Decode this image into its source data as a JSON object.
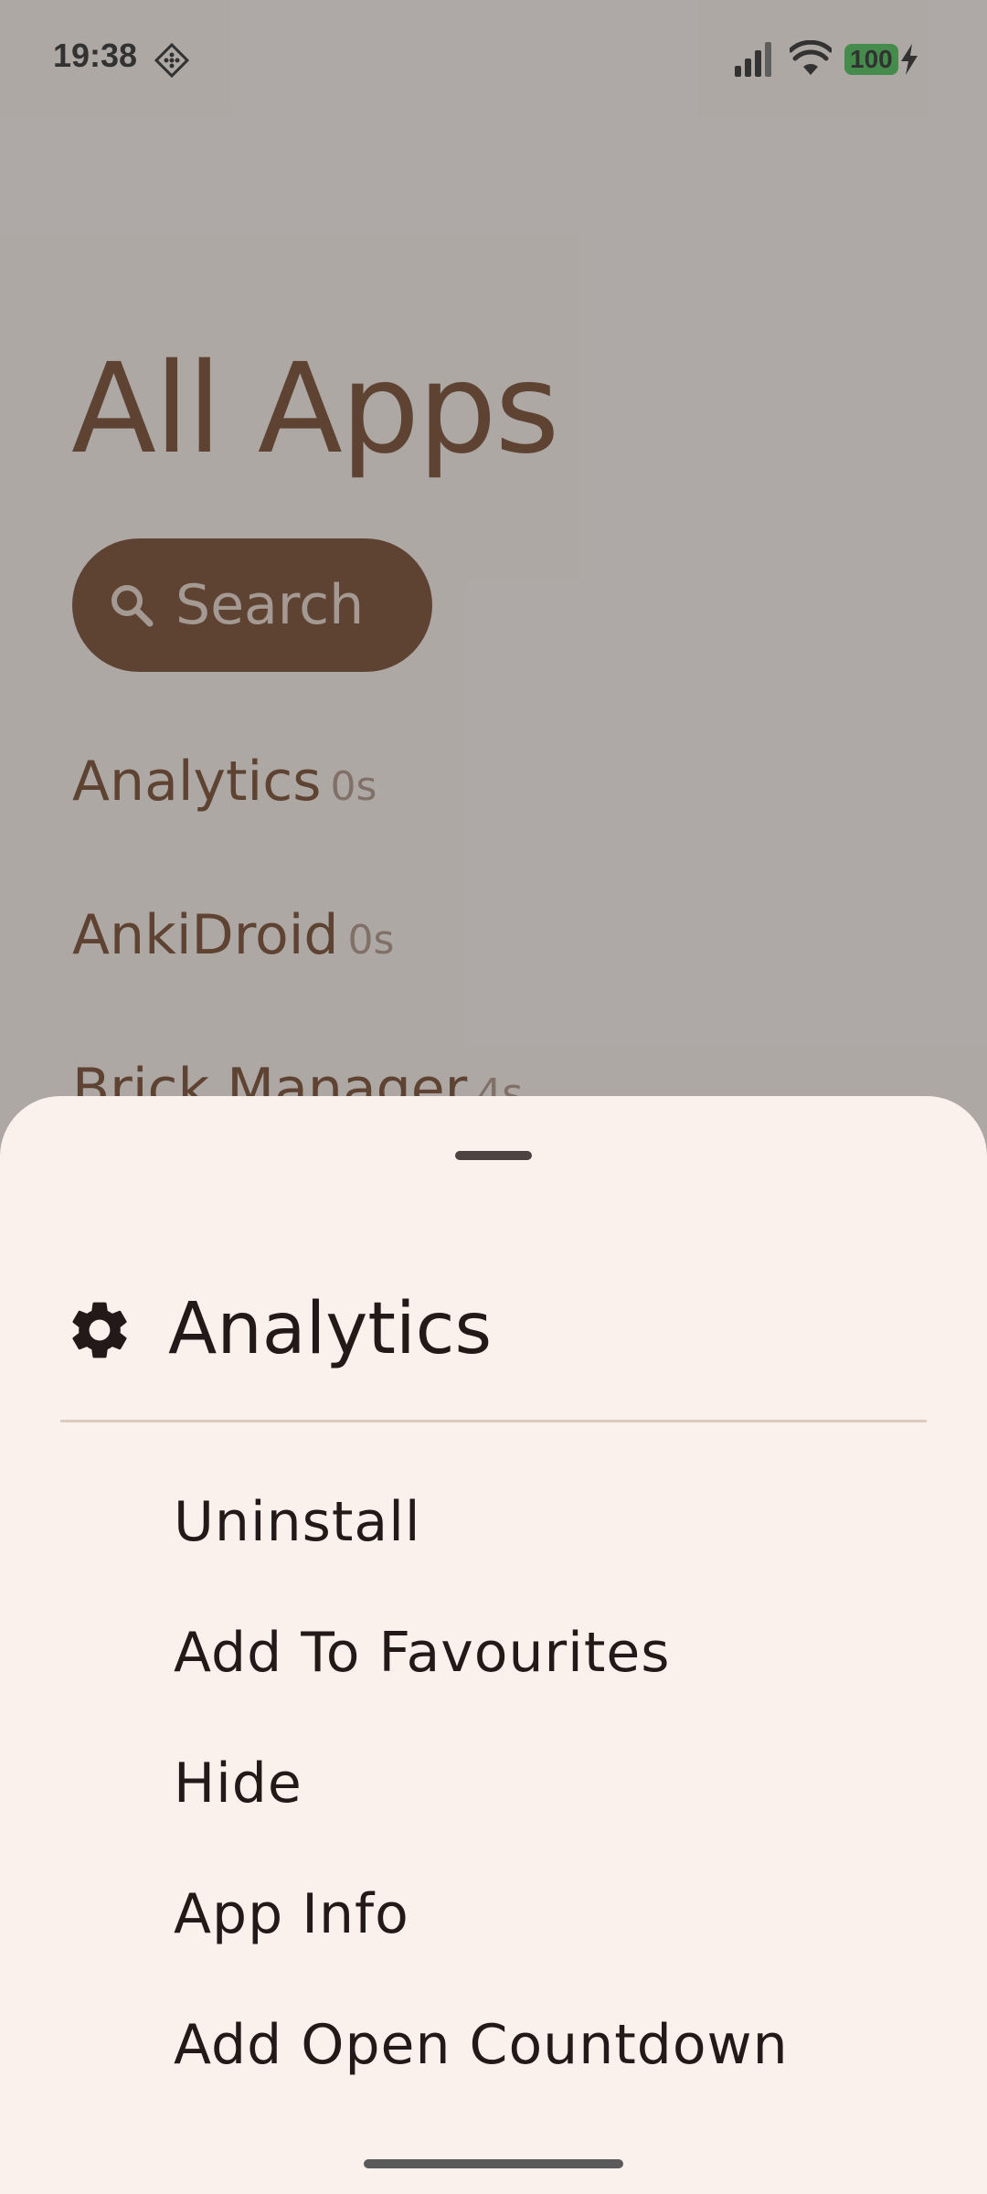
{
  "status_bar": {
    "time": "19:38",
    "battery": "100",
    "icons": [
      "notification-icon",
      "signal-icon",
      "wifi-icon",
      "charging-bolt-icon"
    ]
  },
  "page": {
    "title": "All Apps",
    "search_label": "Search"
  },
  "apps": [
    {
      "name": "Analytics",
      "usage": "0s"
    },
    {
      "name": "AnkiDroid",
      "usage": "0s"
    },
    {
      "name": "Brick Manager",
      "usage": "4s"
    }
  ],
  "sheet": {
    "title": "Analytics",
    "icon": "gear-icon",
    "actions": [
      {
        "label": "Uninstall"
      },
      {
        "label": "Add To Favourites"
      },
      {
        "label": "Hide"
      },
      {
        "label": "App Info"
      },
      {
        "label": "Add Open Countdown"
      }
    ]
  },
  "colors": {
    "accent": "#6b3a1c",
    "sheet_background": "#fbf1ec",
    "battery_green": "#3dbd4a",
    "text_dark": "#231918"
  }
}
